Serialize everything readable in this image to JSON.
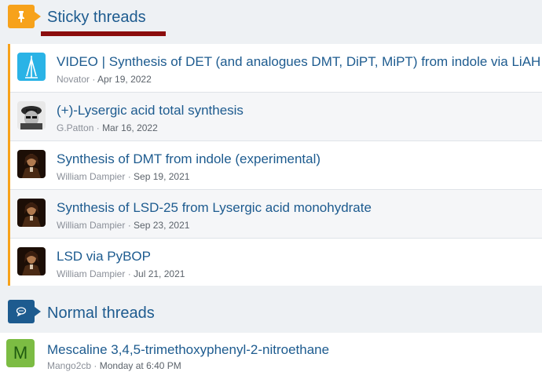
{
  "sticky": {
    "title": "Sticky threads",
    "icon": "pin-icon",
    "accent": "#f7a21b",
    "threads": [
      {
        "title": "VIDEO | Synthesis of DET (and analogues DMT, DiPT, MiPT) from indole via LiAH",
        "author": "Novator",
        "date": "Apr 19, 2022",
        "avatar": "novator-avatar"
      },
      {
        "title": "(+)-Lysergic acid total synthesis",
        "author": "G.Patton",
        "date": "Mar 16, 2022",
        "avatar": "gpatton-avatar"
      },
      {
        "title": "Synthesis of DMT from indole (experimental)",
        "author": "William Dampier",
        "date": "Sep 19, 2021",
        "avatar": "dampier-avatar"
      },
      {
        "title": "Synthesis of LSD-25 from Lysergic acid monohydrate",
        "author": "William Dampier",
        "date": "Sep 23, 2021",
        "avatar": "dampier-avatar"
      },
      {
        "title": "LSD via PyBOP",
        "author": "William Dampier",
        "date": "Jul 21, 2021",
        "avatar": "dampier-avatar"
      }
    ]
  },
  "normal": {
    "title": "Normal threads",
    "icon": "chat-bubble-icon",
    "accent": "#1d5b8f",
    "threads": [
      {
        "title": "Mescaline 3,4,5-trimethoxyphenyl-2-nitroethane",
        "author": "Mango2cb",
        "date": "Monday at 6:40 PM",
        "avatar_letter": "M"
      }
    ]
  },
  "separator": "·"
}
